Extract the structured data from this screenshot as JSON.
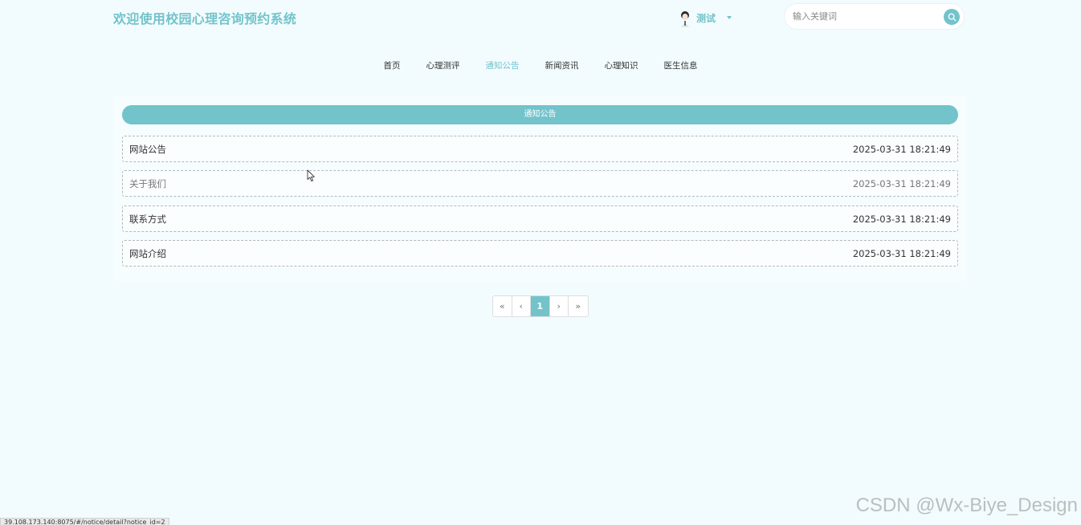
{
  "header": {
    "site_title": "欢迎使用校园心理咨询预约系统",
    "user_name": "测试",
    "search_placeholder": "输入关键词"
  },
  "nav": {
    "items": [
      {
        "label": "首页",
        "active": false
      },
      {
        "label": "心理测评",
        "active": false
      },
      {
        "label": "通知公告",
        "active": true
      },
      {
        "label": "新闻资讯",
        "active": false
      },
      {
        "label": "心理知识",
        "active": false
      },
      {
        "label": "医生信息",
        "active": false
      }
    ]
  },
  "panel": {
    "header": "通知公告",
    "rows": [
      {
        "title": "网站公告",
        "date": "2025-03-31 18:21:49"
      },
      {
        "title": "关于我们",
        "date": "2025-03-31 18:21:49"
      },
      {
        "title": "联系方式",
        "date": "2025-03-31 18:21:49"
      },
      {
        "title": "网站介绍",
        "date": "2025-03-31 18:21:49"
      }
    ]
  },
  "pagination": {
    "first": "«",
    "prev": "‹",
    "current": "1",
    "next": "›",
    "last": "»"
  },
  "status_bar": {
    "url": "39.108.173.140:8075/#/notice/detail?notice_id=2"
  },
  "watermark": "CSDN @Wx-Biye_Design",
  "colors": {
    "accent": "#73c3cb",
    "background": "#f2fcfe"
  }
}
